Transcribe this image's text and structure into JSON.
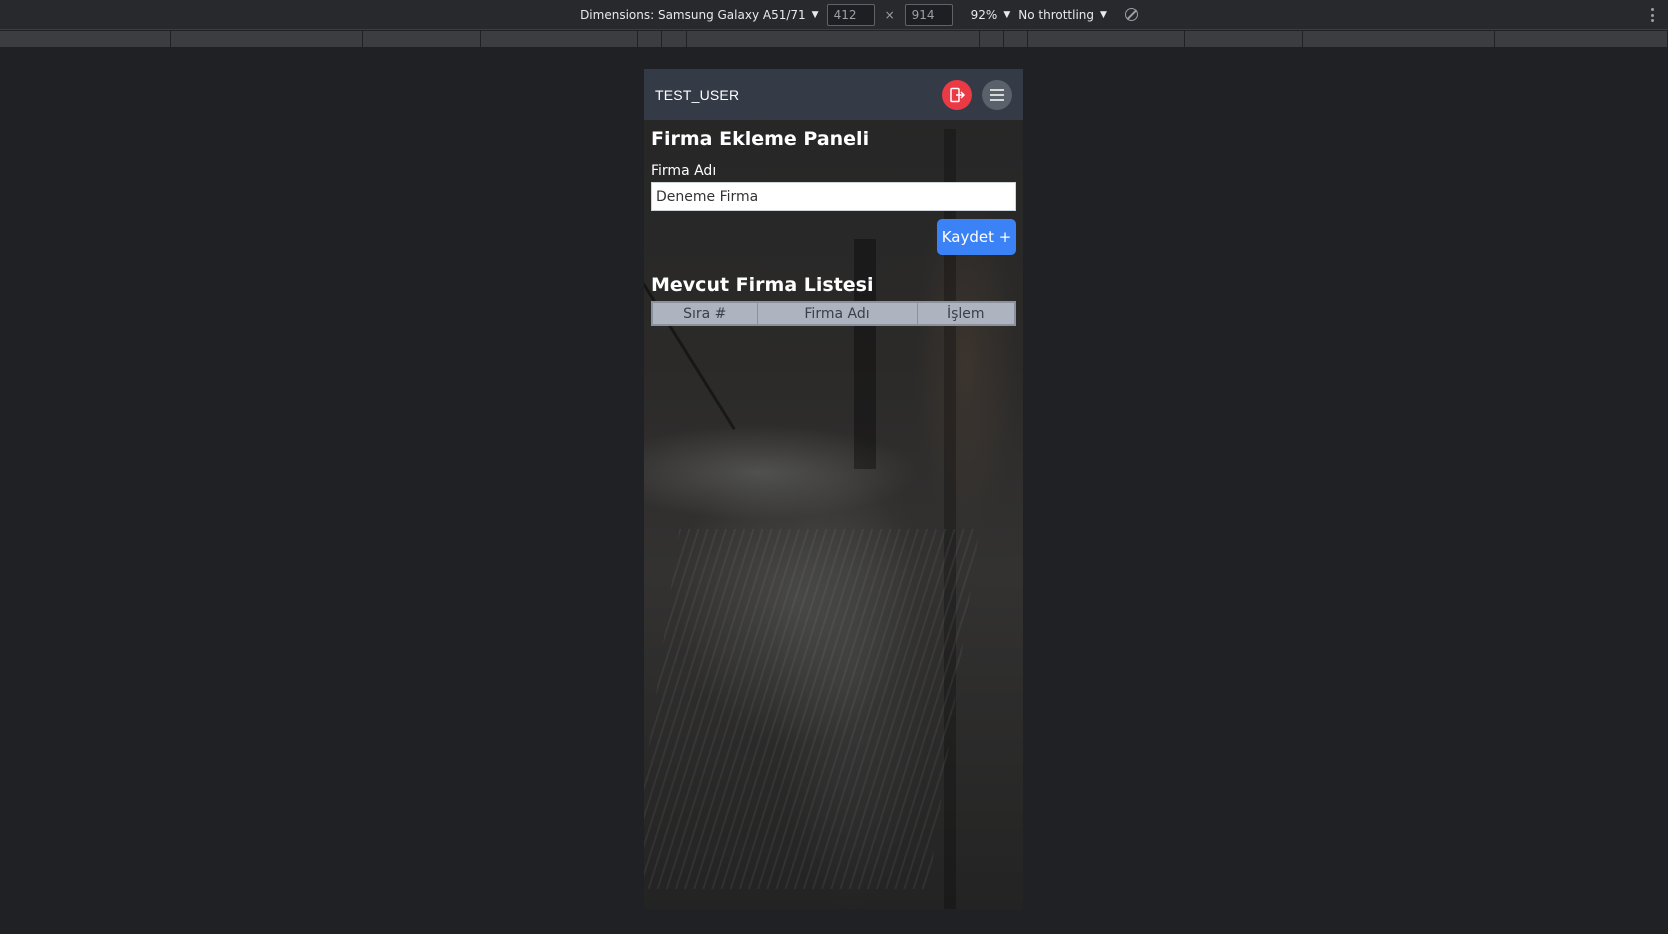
{
  "devtools": {
    "dimensions_label": "Dimensions: Samsung Galaxy A51/71",
    "width_value": "412",
    "height_value": "914",
    "times_sign": "×",
    "zoom": "92%",
    "throttling": "No throttling",
    "caret": "▼",
    "icons": [
      "rotate-icon",
      "kebab-menu-icon"
    ]
  },
  "header": {
    "username": "TEST_USER",
    "logout_icon": "logout-icon",
    "menu_icon": "hamburger-menu-icon",
    "colors": {
      "bar": "#343a46",
      "logout": "#ea3a46",
      "menu": "#5b616b"
    }
  },
  "form": {
    "title": "Firma Ekleme Paneli",
    "field_label": "Firma Adı",
    "field_value": "Deneme Firma",
    "save_label": "Kaydet +",
    "accent": "#3b82f6"
  },
  "list": {
    "title": "Mevcut Firma Listesi",
    "columns": [
      "Sıra #",
      "Firma Adı",
      "İşlem"
    ]
  }
}
